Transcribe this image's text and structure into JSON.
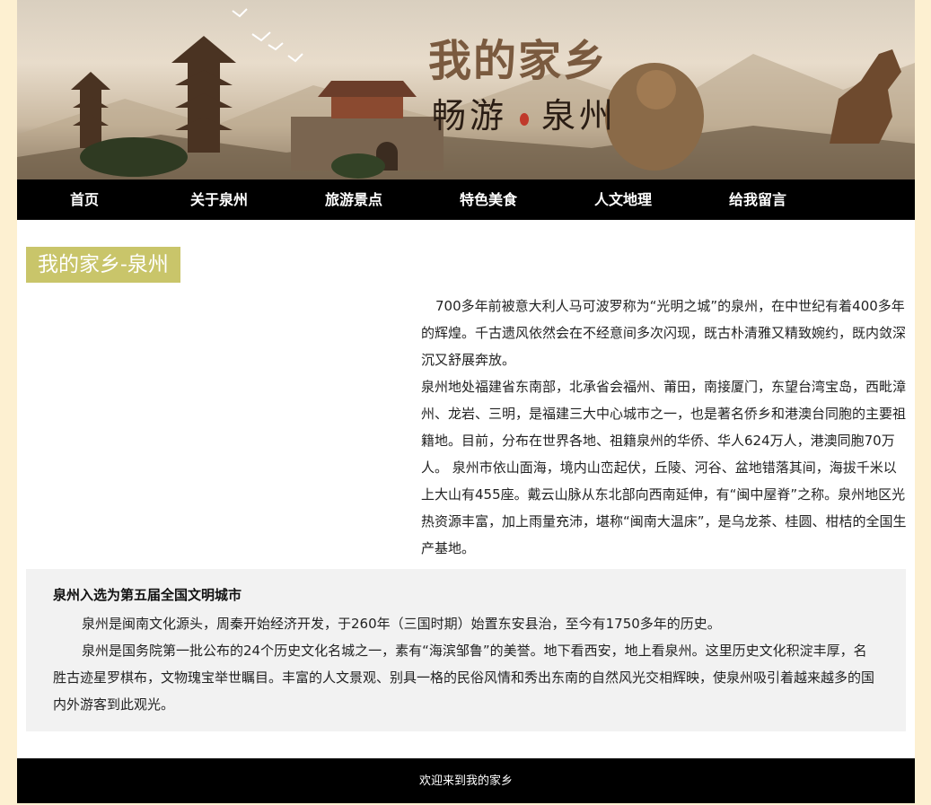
{
  "banner": {
    "title": "我的家乡",
    "sub_left": "畅游",
    "sub_right": "泉州"
  },
  "nav": {
    "items": [
      {
        "label": "首页"
      },
      {
        "label": "关于泉州"
      },
      {
        "label": "旅游景点"
      },
      {
        "label": "特色美食"
      },
      {
        "label": "人文地理"
      },
      {
        "label": "给我留言"
      }
    ]
  },
  "main": {
    "heading": "我的家乡-泉州",
    "intro_p1": "700多年前被意大利人马可波罗称为“光明之城”的泉州，在中世纪有着400多年的辉煌。千古遗风依然会在不经意间多次闪现，既古朴清雅又精致婉约，既内敛深沉又舒展奔放。",
    "intro_p2": "泉州地处福建省东南部，北承省会福州、莆田，南接厦门，东望台湾宝岛，西毗漳州、龙岩、三明，是福建三大中心城市之一，也是著名侨乡和港澳台同胞的主要祖籍地。目前，分布在世界各地、祖籍泉州的华侨、华人624万人，港澳同胞70万人。 泉州市依山面海，境内山峦起伏，丘陵、河谷、盆地错落其间，海拔千米以上大山有455座。戴云山脉从东北部向西南延伸，有“闽中屋脊”之称。泉州地区光热资源丰富，加上雨量充沛，堪称“闽南大温床”，是乌龙茶、桂圆、柑桔的全国生产基地。"
  },
  "infobox": {
    "title": "泉州入选为第五届全国文明城市",
    "para1": "泉州是闽南文化源头，周秦开始经济开发，于260年（三国时期）始置东安县治，至今有1750多年的历史。",
    "para2": "泉州是国务院第一批公布的24个历史文化名城之一，素有“海滨邹鲁”的美誉。地下看西安，地上看泉州。这里历史文化积淀丰厚，名胜古迹星罗棋布，文物瑰宝举世瞩目。丰富的人文景观、别具一格的民俗风情和秀出东南的自然风光交相辉映，使泉州吸引着越来越多的国内外游客到此观光。"
  },
  "footer": {
    "text": "欢迎来到我的家乡"
  },
  "colors": {
    "page_bg": "#fdf0d1",
    "nav_bg": "#000000",
    "heading_bg": "#c9c56a",
    "infobox_bg": "#f2f2f2",
    "banner_title": "#7a5a3f"
  }
}
